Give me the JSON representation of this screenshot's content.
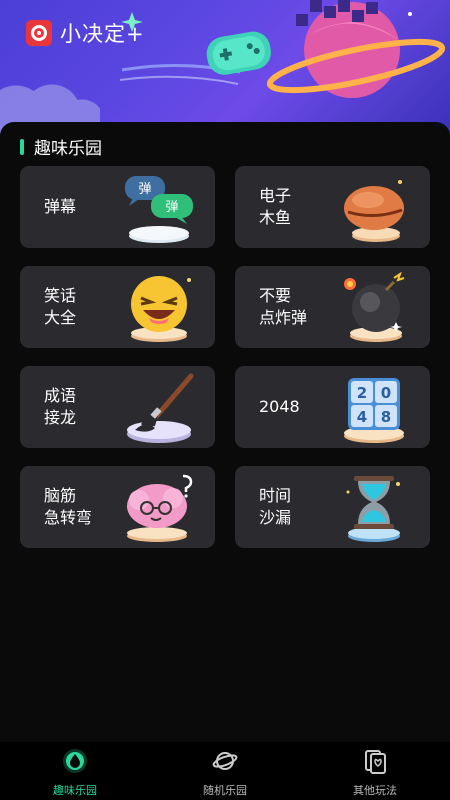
{
  "app": {
    "title": "小决定+"
  },
  "section": {
    "title": "趣味乐园"
  },
  "cards": [
    {
      "label": "弹幕",
      "art": "danmu-bubbles-icon",
      "bubble_top": "弹",
      "bubble_bottom": "弹"
    },
    {
      "label": "电子\n木鱼",
      "art": "wooden-fish-icon"
    },
    {
      "label": "笑话\n大全",
      "art": "laughing-emoji-icon"
    },
    {
      "label": "不要\n点炸弹",
      "art": "bomb-icon"
    },
    {
      "label": "成语\n接龙",
      "art": "brush-icon"
    },
    {
      "label": "2048",
      "art": "tiles-2048-icon",
      "tiles": [
        "2",
        "0",
        "4",
        "8"
      ]
    },
    {
      "label": "脑筋\n急转弯",
      "art": "brain-icon"
    },
    {
      "label": "时间\n沙漏",
      "art": "hourglass-icon"
    }
  ],
  "nav": [
    {
      "label": "趣味乐园",
      "icon": "drop-icon",
      "active": true
    },
    {
      "label": "随机乐园",
      "icon": "planet-icon",
      "active": false
    },
    {
      "label": "其他玩法",
      "icon": "cards-icon",
      "active": false
    }
  ],
  "colors": {
    "accent": "#2bd89a",
    "card_bg": "#2b2b2f",
    "header_bg": "#5a46e0",
    "logo_red": "#e8363c"
  }
}
